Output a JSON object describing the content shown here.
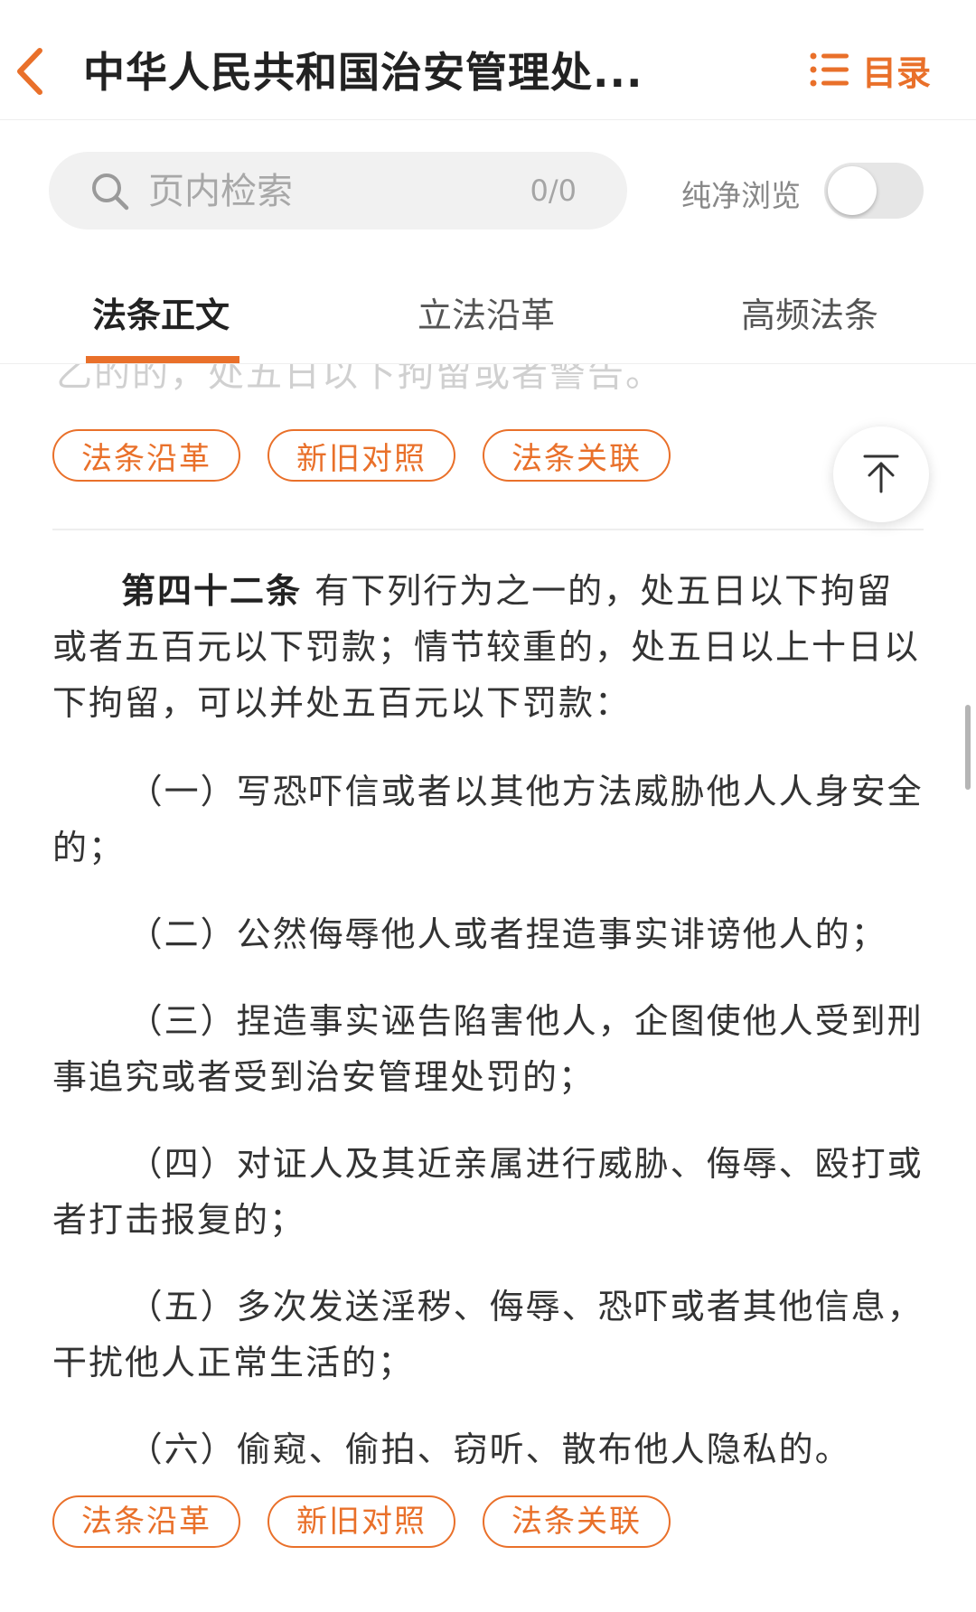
{
  "header": {
    "title": "中华人民共和国治安管理处...",
    "toc_label": "目录"
  },
  "search": {
    "placeholder": "页内检索",
    "count": "0/0"
  },
  "pure_view": {
    "label": "纯净浏览",
    "enabled": false
  },
  "tabs": [
    {
      "label": "法条正文",
      "active": true
    },
    {
      "label": "立法沿革",
      "active": false
    },
    {
      "label": "高频法条",
      "active": false
    }
  ],
  "content": {
    "prev_tail": "乙的的，处五日以下拘留或者警告。",
    "chips_top": [
      "法条沿革",
      "新旧对照",
      "法条关联"
    ],
    "article": {
      "number": "第四十二条",
      "lead": "有下列行为之一的，处五日以下拘留或者五百元以下罚款；情节较重的，处五日以上十日以下拘留，可以并处五百元以下罚款：",
      "items": [
        "（一）写恐吓信或者以其他方法威胁他人人身安全的；",
        "（二）公然侮辱他人或者捏造事实诽谤他人的；",
        "（三）捏造事实诬告陷害他人，企图使他人受到刑事追究或者受到治安管理处罚的；",
        "（四）对证人及其近亲属进行威胁、侮辱、殴打或者打击报复的；",
        "（五）多次发送淫秽、侮辱、恐吓或者其他信息，干扰他人正常生活的；",
        "（六）偷窥、偷拍、窃听、散布他人隐私的。"
      ]
    },
    "chips_bottom": [
      "法条沿革",
      "新旧对照",
      "法条关联"
    ]
  },
  "colors": {
    "accent": "#e9702a",
    "text": "#333333",
    "muted": "#a8a8a8"
  },
  "icons": {
    "back": "chevron-left-icon",
    "toc": "list-icon",
    "search": "search-icon",
    "scroll_top": "arrow-up-to-top-icon"
  }
}
